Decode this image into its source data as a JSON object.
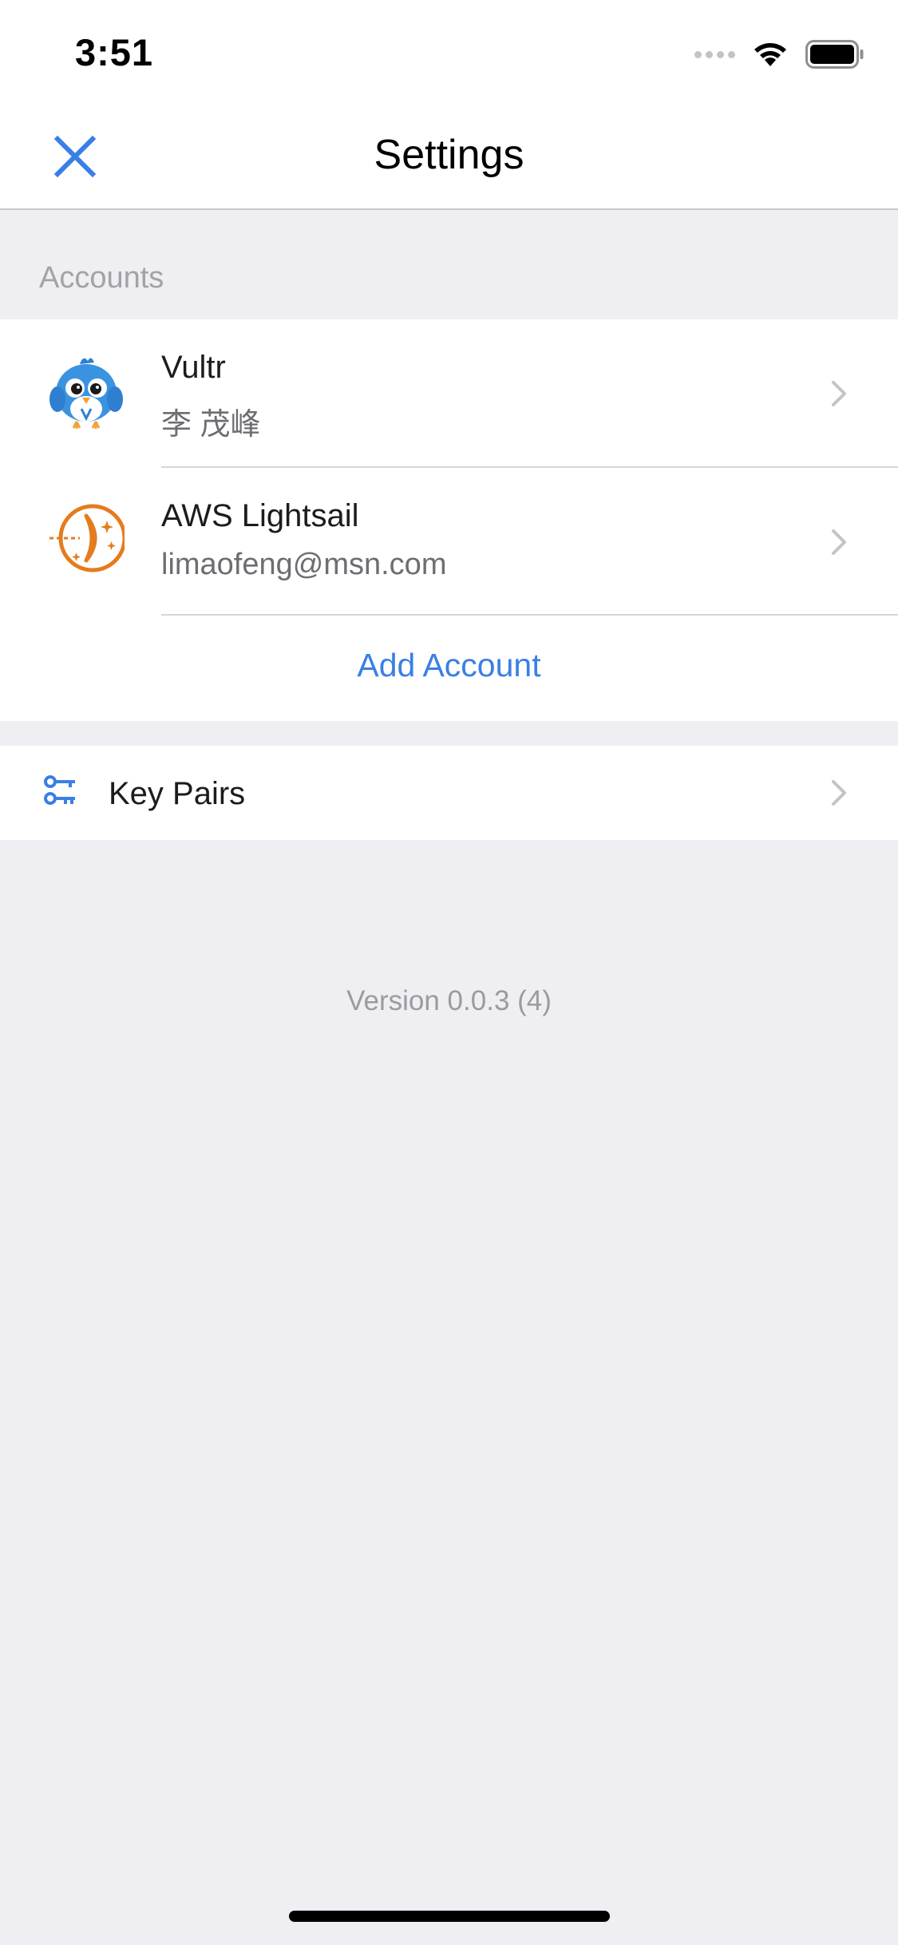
{
  "status_bar": {
    "time": "3:51"
  },
  "nav": {
    "title": "Settings",
    "close_icon": "close-icon"
  },
  "accounts_section": {
    "header": "Accounts",
    "items": [
      {
        "name": "Vultr",
        "subtitle": "李 茂峰",
        "icon": "vultr-bird-logo"
      },
      {
        "name": "AWS Lightsail",
        "subtitle": "limaofeng@msn.com",
        "icon": "aws-lightsail-logo"
      }
    ],
    "add_label": "Add Account"
  },
  "key_pairs": {
    "label": "Key Pairs",
    "icon": "key-icon"
  },
  "footer": {
    "version": "Version 0.0.3 (4)"
  },
  "colors": {
    "accent": "#3a7fe6",
    "background": "#efeff3",
    "lightsail_orange": "#e47c1d",
    "vultr_blue": "#3a93e0"
  }
}
